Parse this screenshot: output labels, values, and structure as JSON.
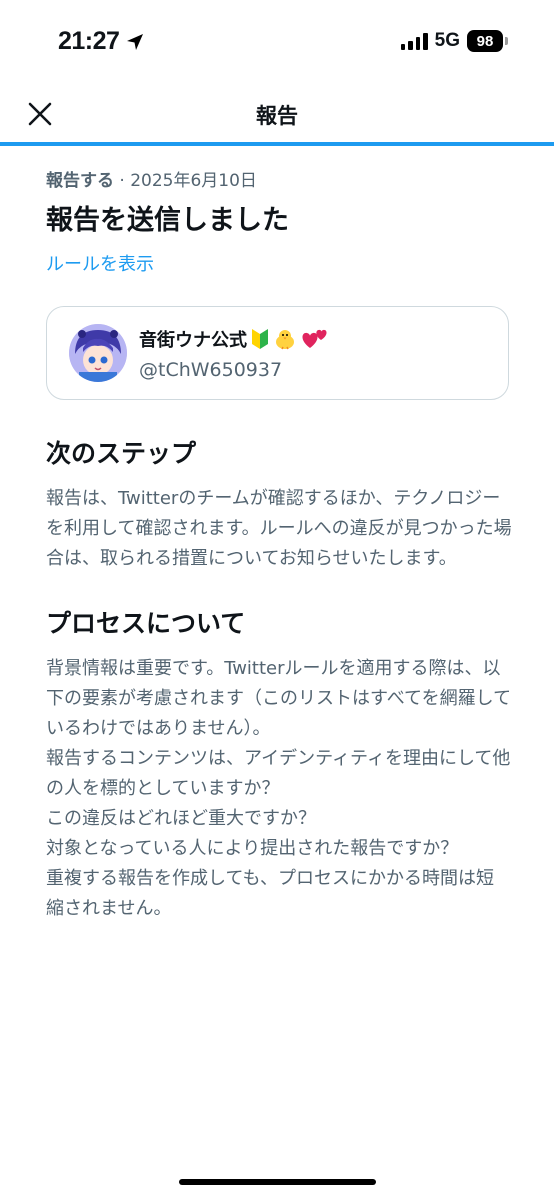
{
  "status_bar": {
    "time": "21:27",
    "network": "5G",
    "battery": "98"
  },
  "header": {
    "title": "報告",
    "close_icon": "close-icon",
    "accent_color": "#1d9bf0"
  },
  "report": {
    "meta_label": "報告する",
    "meta_separator": " · ",
    "meta_date": "2025年6月10日",
    "headline": "報告を送信しました",
    "rules_link": "ルールを表示"
  },
  "account": {
    "name": "音街ウナ公式",
    "badges": [
      "beginner-mark-icon",
      "chick-icon",
      "hearts-icon"
    ],
    "handle": "@tChW650937"
  },
  "next_steps": {
    "title": "次のステップ",
    "body": "報告は、Twitterのチームが確認するほか、テクノロジーを利用して確認されます。ルールへの違反が見つかった場合は、取られる措置についてお知らせいたします。"
  },
  "process": {
    "title": "プロセスについて",
    "paragraphs": [
      "背景情報は重要です。Twitterルールを適用する際は、以下の要素が考慮されます（このリストはすべてを網羅しているわけではありません）。",
      "報告するコンテンツは、アイデンティティを理由にして他の人を標的としていますか？",
      "この違反はどれほど重大ですか？",
      "対象となっている人により提出された報告ですか？",
      "重複する報告を作成しても、プロセスにかかる時間は短縮されません。"
    ]
  }
}
